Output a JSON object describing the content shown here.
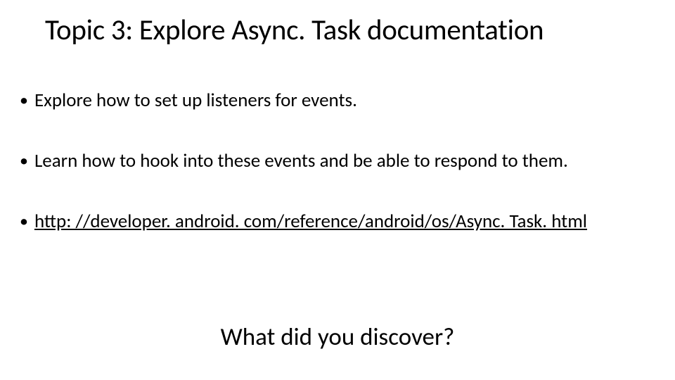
{
  "slide": {
    "title": "Topic 3: Explore Async. Task documentation",
    "bullets": [
      {
        "text": "Explore how to set up listeners for events.",
        "is_link": false
      },
      {
        "text": "Learn how to hook into these events and be able to respond to them.",
        "is_link": false
      },
      {
        "text": "http: //developer. android. com/reference/android/os/Async. Task. html",
        "is_link": true
      }
    ],
    "footer": "What did you discover?"
  }
}
